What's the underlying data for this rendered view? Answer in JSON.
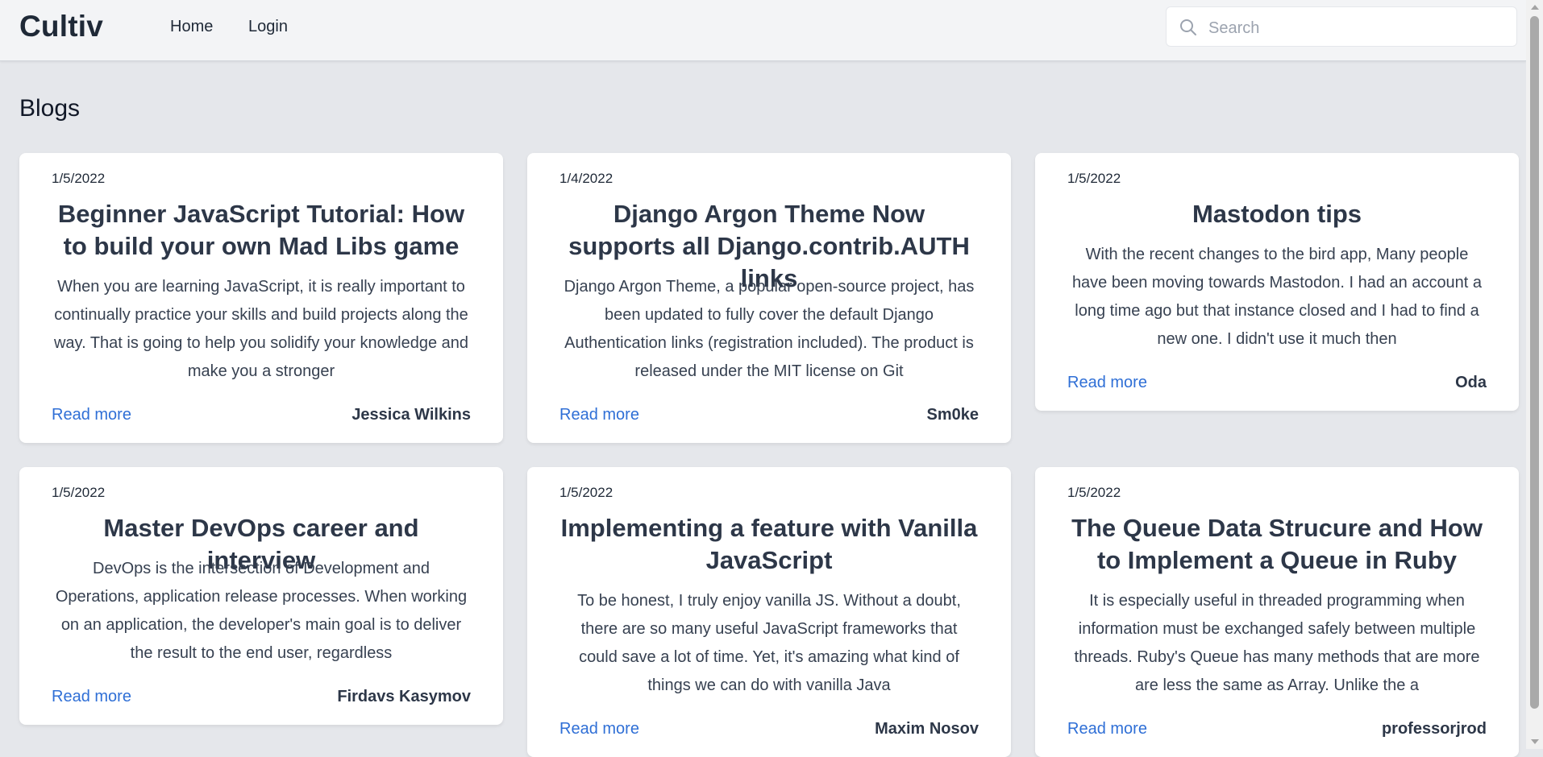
{
  "header": {
    "brand": "Cultiv",
    "nav": [
      {
        "label": "Home"
      },
      {
        "label": "Login"
      }
    ],
    "search": {
      "placeholder": "Search",
      "value": "",
      "icon": "search-icon"
    }
  },
  "main": {
    "title": "Blogs",
    "cards": [
      {
        "date": "1/5/2022",
        "title": "Beginner JavaScript Tutorial: How to build your own Mad Libs game",
        "excerpt": "When you are learning JavaScript, it is really important to continually practice your skills and build projects along the way. That is going to help you solidify your knowledge and make you a stronger",
        "read_more": "Read more",
        "author": "Jessica Wilkins"
      },
      {
        "date": "1/4/2022",
        "title": "Django Argon Theme Now supports all Django.contrib.AUTH links",
        "excerpt": "Django Argon Theme, a popular open-source project, has been updated to fully cover the default Django Authentication links (registration included). The product is released under the MIT license on Git",
        "read_more": "Read more",
        "author": "Sm0ke"
      },
      {
        "date": "1/5/2022",
        "title": "Mastodon tips",
        "excerpt": "With the recent changes to the bird app, Many people have been moving towards Mastodon. I had an account a long time ago but that instance closed and I had to find a new one. I didn't use it much then",
        "read_more": "Read more",
        "author": "Oda"
      },
      {
        "date": "1/5/2022",
        "title": "Master DevOps career and interview",
        "excerpt": "DevOps is the intersection of Development and Operations, application release processes. When working on an application, the developer's main goal is to deliver the result to the end user, regardless",
        "read_more": "Read more",
        "author": "Firdavs Kasymov"
      },
      {
        "date": "1/5/2022",
        "title": "Implementing a feature with Vanilla JavaScript",
        "excerpt": "To be honest, I truly enjoy vanilla JS. Without a doubt, there are so many useful JavaScript frameworks that could save a lot of time. Yet, it's amazing what kind of things we can do with vanilla Java",
        "read_more": "Read more",
        "author": "Maxim Nosov"
      },
      {
        "date": "1/5/2022",
        "title": "The Queue Data Strucure and How to Implement a Queue in Ruby",
        "excerpt": "It is especially useful in threaded programming when information must be exchanged safely between multiple threads. Ruby's Queue has many methods that are more are less the same as Array. Unlike the a",
        "read_more": "Read more",
        "author": "professorjrod"
      }
    ]
  },
  "colors": {
    "background": "#e5e7eb",
    "card": "#ffffff",
    "link": "#2f6fd6",
    "title": "#2d3748"
  }
}
